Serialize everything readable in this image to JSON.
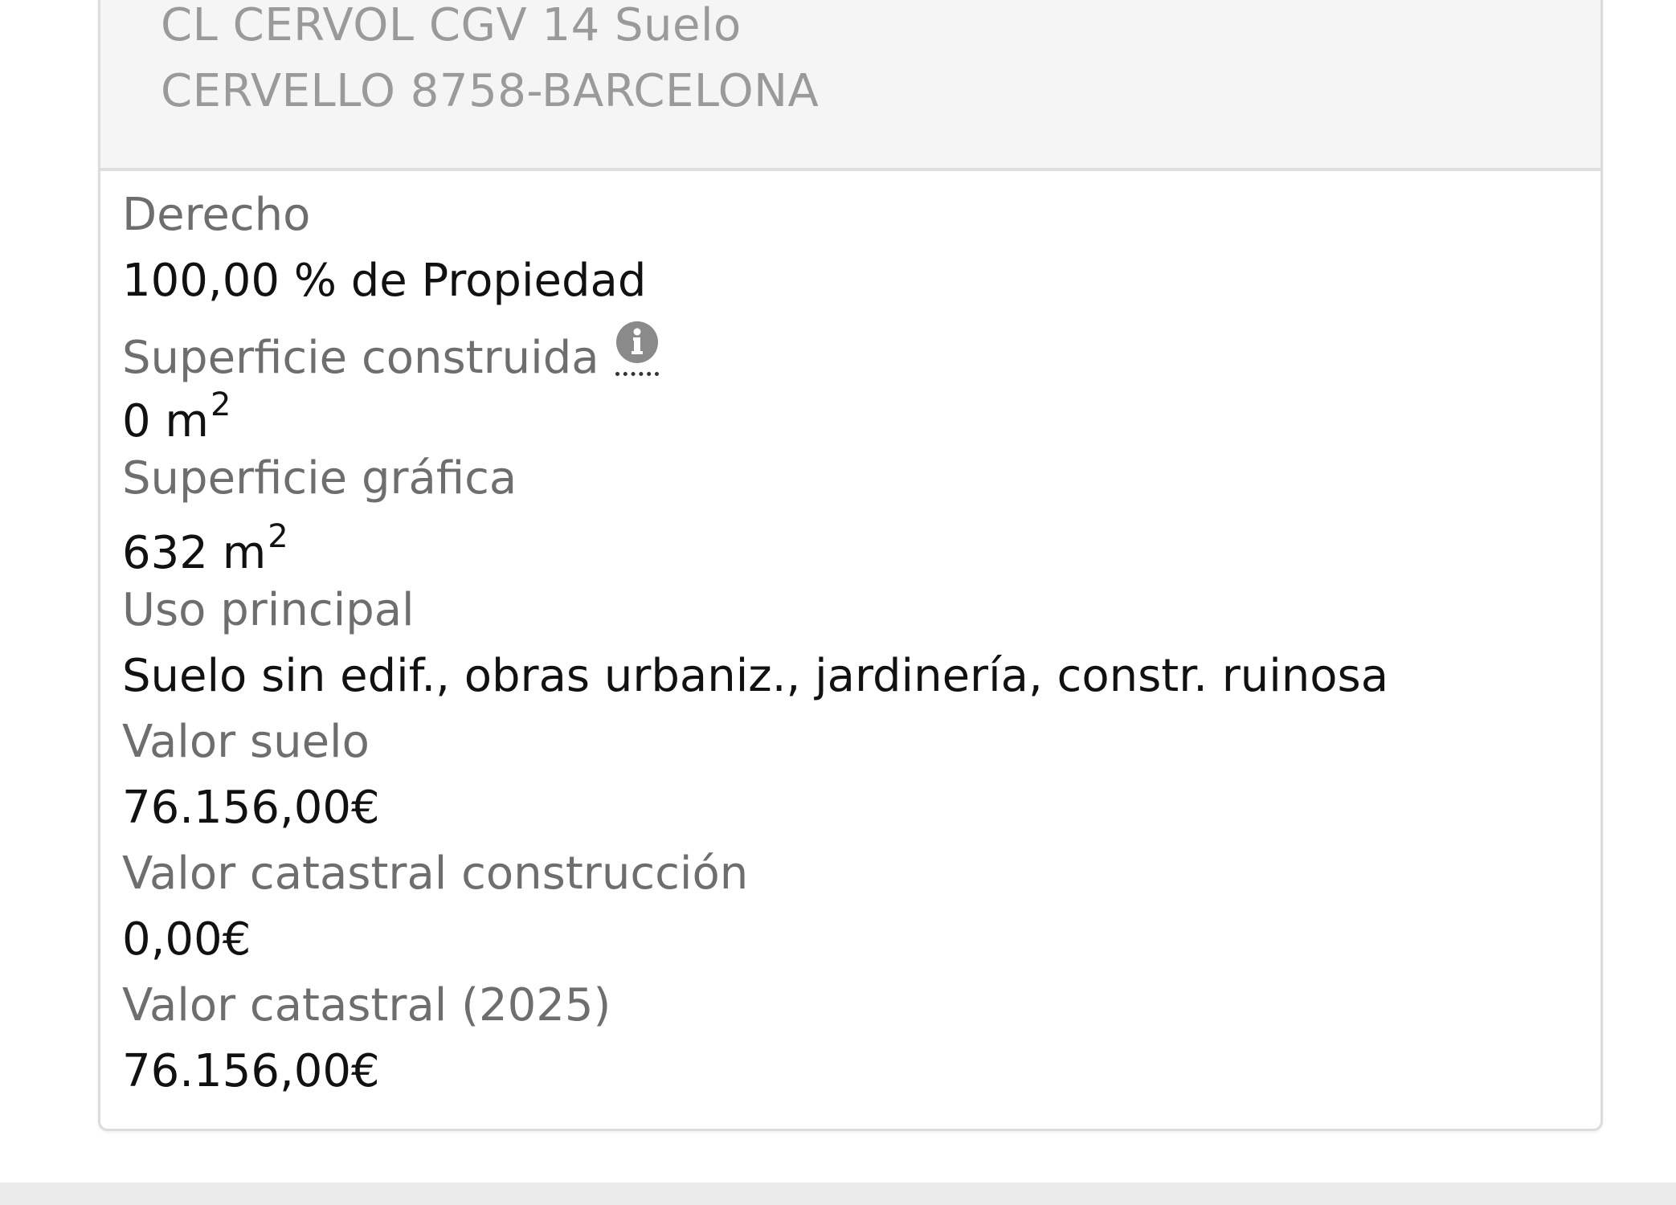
{
  "address": {
    "line1": "CL CERVOL CGV 14 Suelo",
    "line2": "CERVELLO 8758-BARCELONA"
  },
  "details": {
    "derecho_label": "Derecho",
    "derecho_value": "100,00 % de Propiedad",
    "superficie_construida_label": "Superficie construida",
    "superficie_construida_value": "0 m",
    "superficie_grafica_label": "Superficie gráfica",
    "superficie_grafica_value": "632 m",
    "area_unit_exponent": "2",
    "uso_principal_label": "Uso principal",
    "uso_principal_value": "Suelo sin edif., obras urbaniz., jardinería, constr. ruinosa",
    "valor_suelo_label": "Valor suelo",
    "valor_suelo_value": "76.156,00€",
    "valor_construccion_label": "Valor catastral construcción",
    "valor_construccion_value": "0,00€",
    "valor_catastral_label": "Valor catastral (2025)",
    "valor_catastral_value": "76.156,00€"
  },
  "icons": {
    "info": "info-circle-icon"
  },
  "colors": {
    "label": "#6e6e6e",
    "value": "#111111",
    "address": "#9a9a9a",
    "address_bg": "#f5f5f5"
  }
}
